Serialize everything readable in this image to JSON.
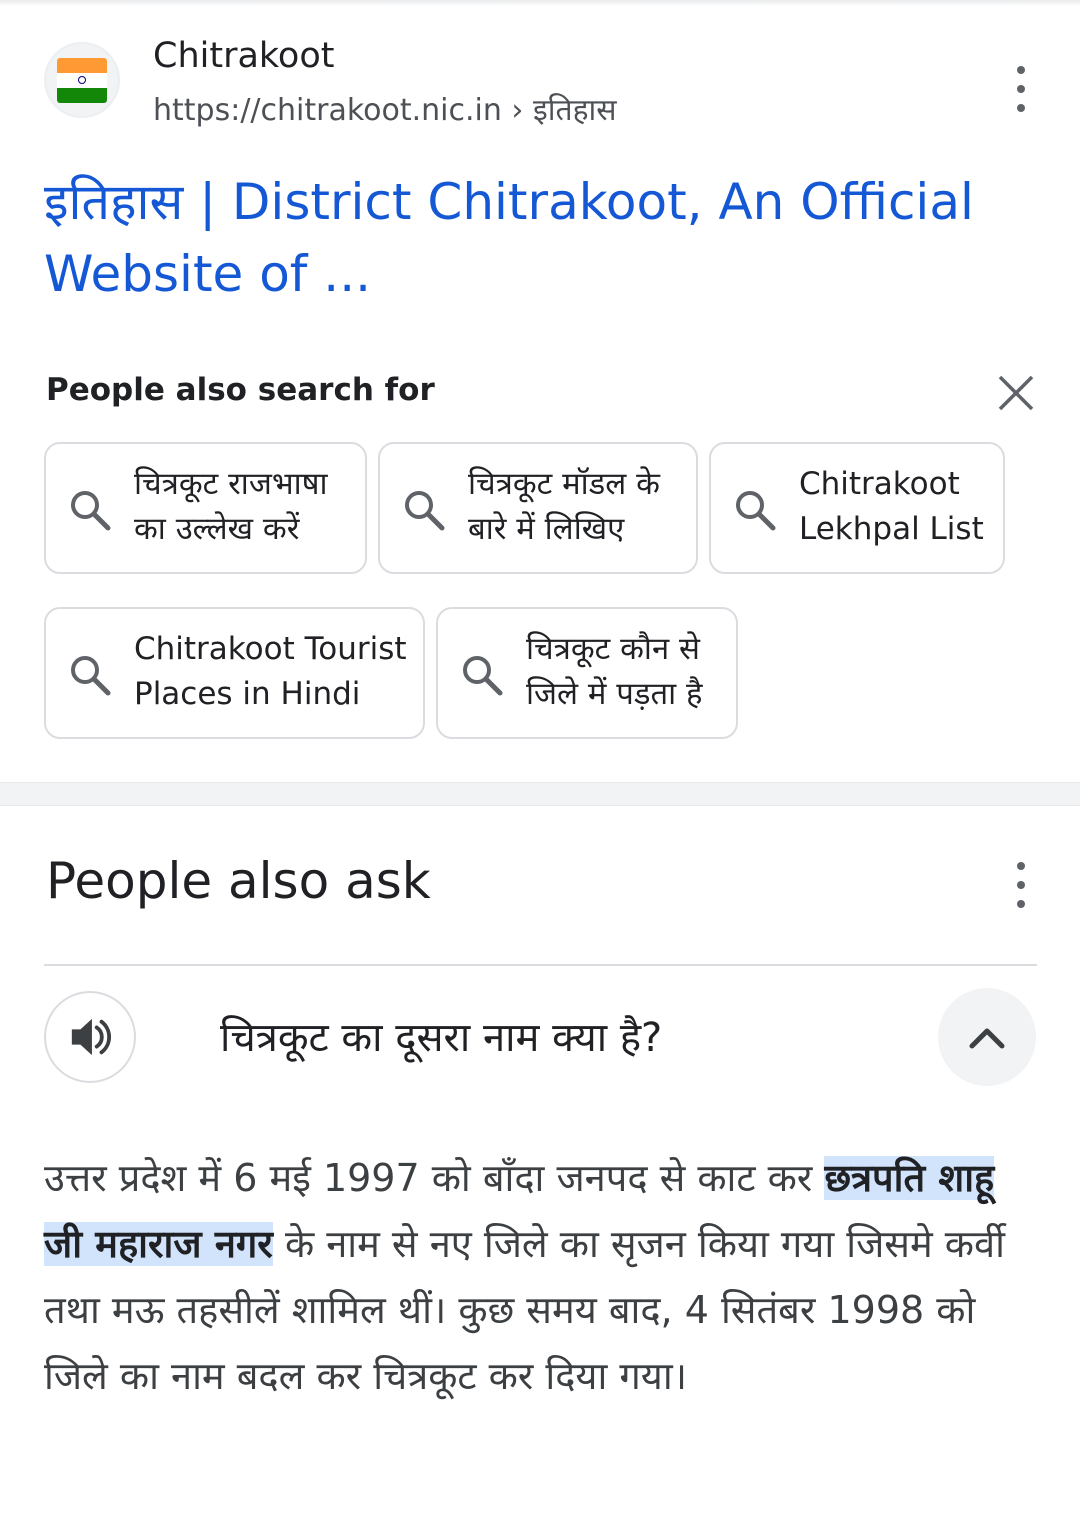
{
  "result": {
    "site_name": "Chitrakoot",
    "url": "https://chitrakoot.nic.in › इतिहास",
    "title": "इतिहास | District Chitrakoot, An Official Website of ..."
  },
  "people_also_search": {
    "heading": "People also search for",
    "chips": [
      {
        "line1": "चित्रकूट राजभाषा",
        "line2": "का उल्लेख करें"
      },
      {
        "line1": "चित्रकूट मॉडल के",
        "line2": "बारे में लिखिए"
      },
      {
        "line1": "Chitrakoot",
        "line2": "Lekhpal List"
      },
      {
        "line1": "Chitrakoot Tourist",
        "line2": "Places in Hindi"
      },
      {
        "line1": "चित्रकूट कौन से",
        "line2": "जिले में पड़ता है"
      }
    ]
  },
  "people_also_ask": {
    "heading": "People also ask",
    "question": "चित्रकूट का दूसरा नाम क्या है?",
    "answer_before": "उत्तर प्रदेश में 6 मई 1997 को बाँदा जनपद से काट कर ",
    "answer_highlight": "छत्रपति शाहू जी महाराज नगर",
    "answer_after": " के नाम से नए जिले का सृजन किया गया जिसमे कर्वी तथा मऊ तहसीलें शामिल थीं। कुछ समय बाद, 4 सितंबर 1998 को जिले का नाम बदल कर चित्रकूट कर दिया गया।"
  },
  "icons": {
    "favicon": "india-flag-icon",
    "menu": "more-vert-icon",
    "close": "close-icon",
    "search": "search-icon",
    "speaker": "volume-icon",
    "collapse": "chevron-up-icon"
  },
  "colors": {
    "link": "#1558d6",
    "highlight": "#d2e3fc",
    "chip_border": "#dadce0"
  }
}
